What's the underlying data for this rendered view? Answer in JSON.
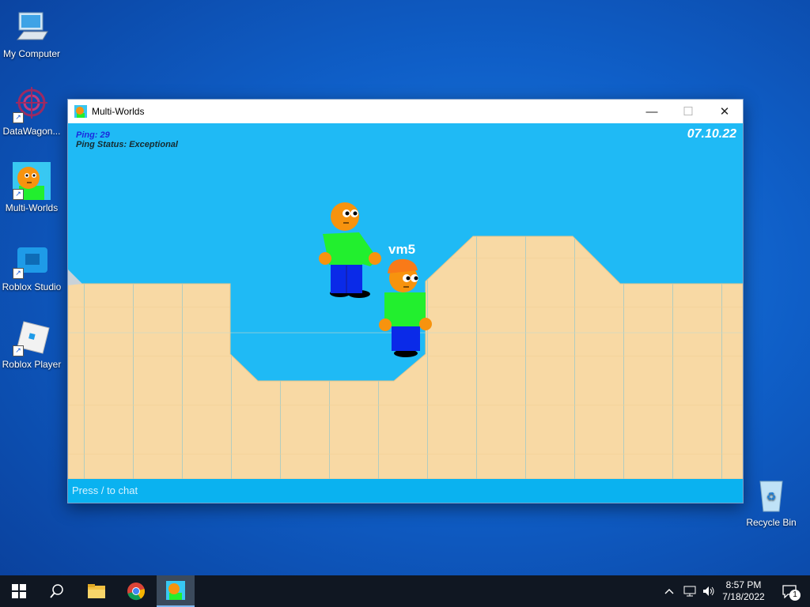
{
  "desktop": {
    "icons": [
      {
        "label": "My Computer"
      },
      {
        "label": "DataWagon..."
      },
      {
        "label": "Multi-Worlds"
      },
      {
        "label": "Roblox Studio"
      },
      {
        "label": "Roblox Player"
      },
      {
        "label": "Recycle Bin"
      }
    ]
  },
  "window": {
    "title": "Multi-Worlds",
    "minimize_glyph": "—",
    "maximize_glyph": "☐",
    "close_glyph": "✕"
  },
  "game": {
    "ping": "Ping: 29",
    "ping_status": "Ping Status: Exceptional",
    "date": "07.10.22",
    "player_name": "vm5",
    "chat_hint": "Press / to chat",
    "colors": {
      "sky": "#1fbaf5",
      "sand": "#f8d9a4",
      "shirt": "#22ef2e",
      "pants": "#0a2ae8",
      "skin": "#f7930e",
      "hat": "#f97a18"
    }
  },
  "taskbar": {
    "time": "8:57 PM",
    "date": "7/18/2022",
    "notification_count": "1",
    "apps": [
      "start-icon",
      "search-icon",
      "file-explorer-icon",
      "chrome-icon",
      "multi-worlds-icon"
    ]
  }
}
